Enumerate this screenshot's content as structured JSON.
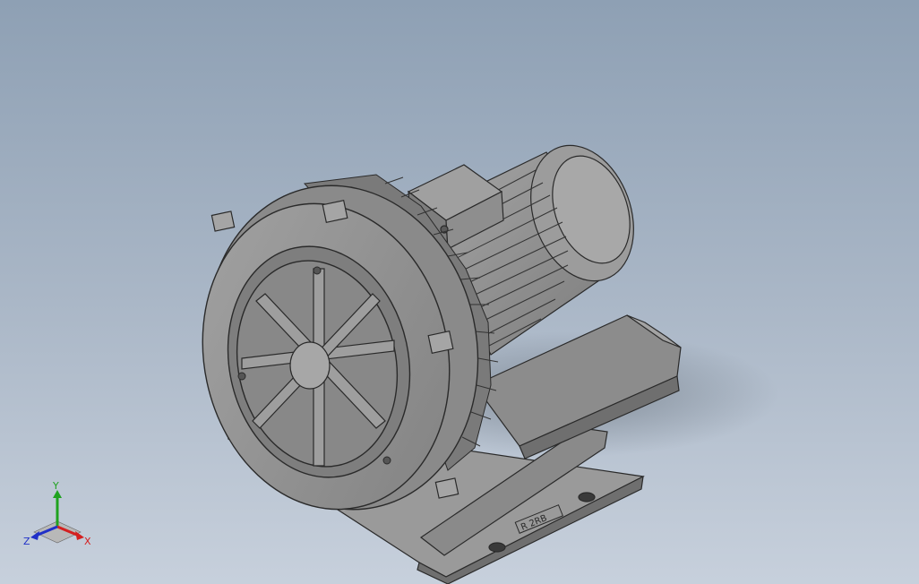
{
  "viewport": {
    "background_top": "#8ea0b4",
    "background_bottom": "#c7d0dc"
  },
  "model": {
    "name": "",
    "body_color": "#8f8f8f",
    "edge_color": "#2a2a2a",
    "plate_logo": "R 2RB"
  },
  "triad": {
    "x_label": "X",
    "y_label": "Y",
    "z_label": "Z",
    "x_color": "#d42020",
    "y_color": "#1fa21f",
    "z_color": "#2030c8"
  }
}
